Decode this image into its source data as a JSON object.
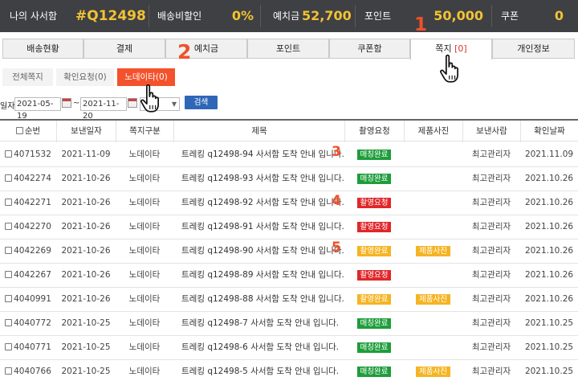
{
  "summary": {
    "name_label": "나의 사서함",
    "mailbox_code": "#Q12498",
    "shipping_discount_label": "배송비할인",
    "shipping_discount_value": "0%",
    "deposit_label": "예치금",
    "deposit_value": "52,700",
    "points_label": "포인트",
    "points_value": "50,000",
    "coupon_label": "쿠폰",
    "coupon_value": "0"
  },
  "tabs": [
    {
      "label": "배송현황"
    },
    {
      "label": "결제"
    },
    {
      "label": "예치금"
    },
    {
      "label": "포인트"
    },
    {
      "label": "쿠폰함"
    },
    {
      "label": "쪽지",
      "count": "[0]"
    },
    {
      "label": "개인정보"
    }
  ],
  "subtabs": [
    {
      "label": "전체쪽지"
    },
    {
      "label": "확인요청(0)"
    },
    {
      "label": "노데이타(0)"
    }
  ],
  "search": {
    "date_label": "일자",
    "from_date": "2021-05-19",
    "tilde": "~",
    "to_date": "2021-11-20",
    "button_label": "검색"
  },
  "table": {
    "columns": [
      "순번",
      "보낸일자",
      "쪽지구분",
      "제목",
      "촬영요청",
      "제품사진",
      "보낸사람",
      "확인날짜"
    ],
    "rows": [
      {
        "id": "4071532",
        "date": "2021-11-09",
        "type": "노데이타",
        "title": "트레킹 q12498-94 사서함 도착 안내 입니다.",
        "photo_status": "매칭완료",
        "product_photo": "",
        "sender": "최고관리자",
        "confirm_date": "2021.11.09"
      },
      {
        "id": "4042274",
        "date": "2021-10-26",
        "type": "노데이타",
        "title": "트레킹 q12498-93 사서함 도착 안내 입니다.",
        "photo_status": "매칭완료",
        "product_photo": "",
        "sender": "최고관리자",
        "confirm_date": "2021.10.26"
      },
      {
        "id": "4042271",
        "date": "2021-10-26",
        "type": "노데이타",
        "title": "트레킹 q12498-92 사서함 도착 안내 입니다.",
        "photo_status": "촬영요청",
        "product_photo": "",
        "sender": "최고관리자",
        "confirm_date": "2021.10.26"
      },
      {
        "id": "4042270",
        "date": "2021-10-26",
        "type": "노데이타",
        "title": "트레킹 q12498-91 사서함 도착 안내 입니다.",
        "photo_status": "촬영요청",
        "product_photo": "",
        "sender": "최고관리자",
        "confirm_date": "2021.10.26"
      },
      {
        "id": "4042269",
        "date": "2021-10-26",
        "type": "노데이타",
        "title": "트레킹 q12498-90 사서함 도착 안내 입니다.",
        "photo_status": "촬영완료",
        "product_photo": "제품사진",
        "sender": "최고관리자",
        "confirm_date": "2021.10.26"
      },
      {
        "id": "4042267",
        "date": "2021-10-26",
        "type": "노데이타",
        "title": "트레킹 q12498-89 사서함 도착 안내 입니다.",
        "photo_status": "촬영요청",
        "product_photo": "",
        "sender": "최고관리자",
        "confirm_date": "2021.10.26"
      },
      {
        "id": "4040991",
        "date": "2021-10-26",
        "type": "노데이타",
        "title": "트레킹 q12498-88 사서함 도착 안내 입니다.",
        "photo_status": "촬영완료",
        "product_photo": "제품사진",
        "sender": "최고관리자",
        "confirm_date": "2021.10.26"
      },
      {
        "id": "4040772",
        "date": "2021-10-25",
        "type": "노데이타",
        "title": "트레킹 q12498-7 사서함 도착 안내 입니다.",
        "photo_status": "매칭완료",
        "product_photo": "",
        "sender": "최고관리자",
        "confirm_date": "2021.10.25"
      },
      {
        "id": "4040771",
        "date": "2021-10-25",
        "type": "노데이타",
        "title": "트레킹 q12498-6 사서함 도착 안내 입니다.",
        "photo_status": "매칭완료",
        "product_photo": "",
        "sender": "최고관리자",
        "confirm_date": "2021.10.25"
      },
      {
        "id": "4040766",
        "date": "2021-10-25",
        "type": "노데이타",
        "title": "트레킹 q12498-5 사서함 도착 안내 입니다.",
        "photo_status": "매칭완료",
        "product_photo": "제품사진",
        "sender": "최고관리자",
        "confirm_date": "2021.10.25"
      }
    ]
  },
  "annotations": [
    "1",
    "2",
    "3",
    "4",
    "5"
  ],
  "colors": {
    "topbar_bg": "#3f4043",
    "topbar_value": "#f2c233",
    "accent_orange": "#f4522c",
    "search_button": "#2f67b8",
    "badge_matched": "#1e9d3b",
    "badge_request": "#e0272a",
    "badge_done": "#f5b423"
  },
  "icons": {
    "cursor": "hand-pointer-icon",
    "calendar": "calendar-icon",
    "dropdown": "chevron-down-icon"
  }
}
